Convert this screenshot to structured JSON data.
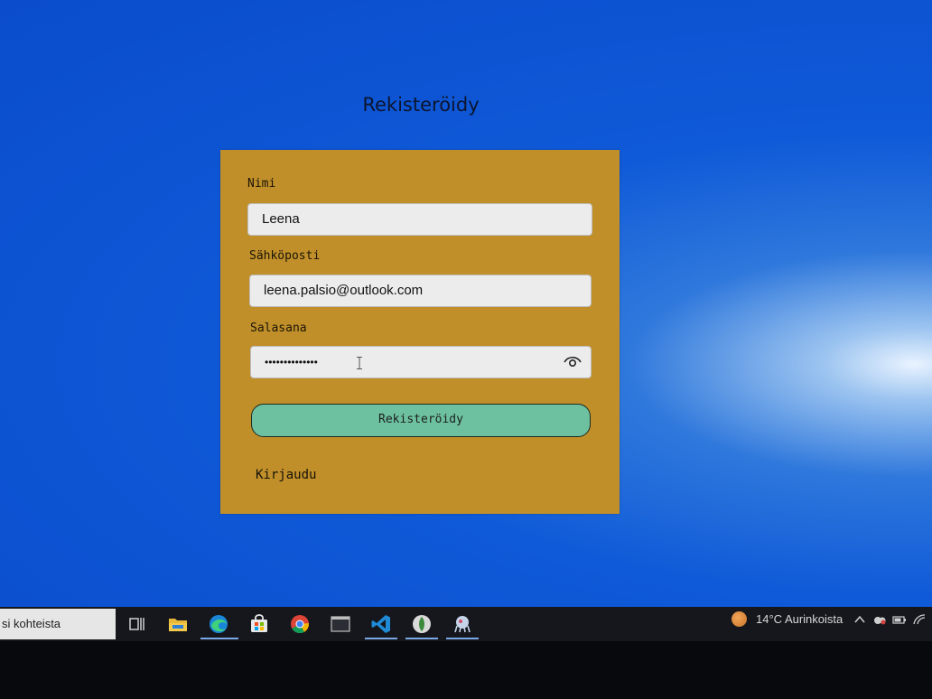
{
  "page": {
    "title": "Rekisteröidy"
  },
  "form": {
    "name_label": "Nimi",
    "name_value": "Leena",
    "email_label": "Sähköposti",
    "email_value": "leena.palsio@outlook.com",
    "password_label": "Salasana",
    "password_mask": "••••••••••••••",
    "submit_label": "Rekisteröidy",
    "login_link": "Kirjaudu"
  },
  "taskbar": {
    "search_text": "si kohteista",
    "icons": [
      "task-view-icon",
      "file-explorer-icon",
      "edge-icon",
      "store-icon",
      "chrome-icon",
      "terminal-icon",
      "vscode-icon",
      "app-icon",
      "app-icon-2"
    ],
    "weather": "14°C  Aurinkoista"
  },
  "colors": {
    "screen_bg": "#0a4ccc",
    "card_bg": "#c08f2a",
    "button_bg": "#6ec1a0",
    "input_bg": "#ececec"
  }
}
